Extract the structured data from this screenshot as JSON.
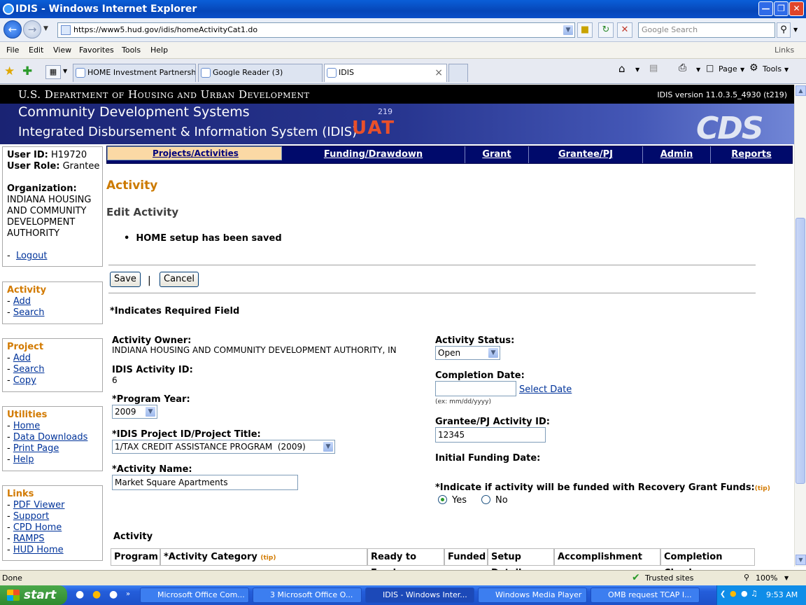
{
  "window": {
    "title": "IDIS - Windows Internet Explorer"
  },
  "browser": {
    "url": "https://www5.hud.gov/idis/homeActivityCat1.do",
    "search_placeholder": "Google Search",
    "links_label": "Links",
    "menu": [
      "File",
      "Edit",
      "View",
      "Favorites",
      "Tools",
      "Help"
    ],
    "tabs": [
      "HOME Investment Partnershi...",
      "Google Reader (3)",
      "IDIS"
    ],
    "cmd": {
      "page": "Page",
      "tools": "Tools"
    }
  },
  "header": {
    "agency": "U.S. Department of Housing and Urban Development",
    "version": "IDIS version 11.0.3.5_4930 (t219)",
    "system": "Community Development Systems",
    "subsystem": "Integrated Disbursement & Information System (IDIS)",
    "env": "UAT",
    "env_num": "219",
    "logo": "CDS"
  },
  "user": {
    "id_label": "User ID:",
    "id": "H19720",
    "role_label": "User Role:",
    "role": "Grantee",
    "org_label": "Organization:",
    "org": [
      "INDIANA HOUSING",
      "AND COMMUNITY",
      "DEVELOPMENT",
      "AUTHORITY"
    ],
    "logout": "Logout"
  },
  "sidenav": {
    "activity": {
      "title": "Activity",
      "items": [
        "Add",
        "Search"
      ]
    },
    "project": {
      "title": "Project",
      "items": [
        "Add",
        "Search",
        "Copy"
      ]
    },
    "utilities": {
      "title": "Utilities",
      "items": [
        "Home",
        "Data Downloads",
        "Print Page",
        "Help"
      ]
    },
    "links": {
      "title": "Links",
      "items": [
        "PDF Viewer",
        "Support",
        "CPD Home",
        "RAMPS",
        "HUD Home"
      ]
    }
  },
  "topnav": [
    "Projects/Activities",
    "Funding/Drawdown",
    "Grant",
    "Grantee/PJ",
    "Admin",
    "Reports"
  ],
  "main": {
    "title": "Activity",
    "subtitle": "Edit Activity",
    "message": "HOME setup has been saved",
    "save": "Save",
    "cancel": "Cancel",
    "separator": "|",
    "required_note": "*Indicates Required Field",
    "owner_label": "Activity Owner:",
    "owner": "INDIANA HOUSING AND COMMUNITY DEVELOPMENT AUTHORITY, IN",
    "id_label": "IDIS Activity ID:",
    "id": "6",
    "year_label": "*Program Year:",
    "year": "2009",
    "project_label": "*IDIS Project ID/Project Title:",
    "project": "1/TAX CREDIT ASSISTANCE PROGRAM  (2009)",
    "name_label": "*Activity Name:",
    "name": "Market Square Apartments",
    "status_label": "Activity Status:",
    "status": "Open",
    "completion_label": "Completion Date:",
    "completion": "",
    "select_date": "Select Date",
    "date_hint": "(ex: mm/dd/yyyy)",
    "grantee_label": "Grantee/PJ Activity ID:",
    "grantee_id": "12345",
    "initial_label": "Initial Funding Date:",
    "recovery_label": "*Indicate if activity will be funded with Recovery Grant Funds:",
    "tip": "(tip)",
    "yes": "Yes",
    "no": "No",
    "table_title": "Activity",
    "columns": [
      "Program",
      "*Activity Category",
      "(tip)",
      "Ready to Fund",
      "Funded",
      "Setup Detail",
      "Accomplishment",
      "Completion Check"
    ]
  },
  "status": {
    "text": "Done",
    "zone": "Trusted sites",
    "zoom": "100%"
  },
  "taskbar": {
    "start": "start",
    "items": [
      "Microsoft Office Com...",
      "3 Microsoft Office O...",
      "IDIS - Windows Inter...",
      "Windows Media Player",
      "OMB request TCAP I..."
    ],
    "time": "9:53 AM"
  }
}
